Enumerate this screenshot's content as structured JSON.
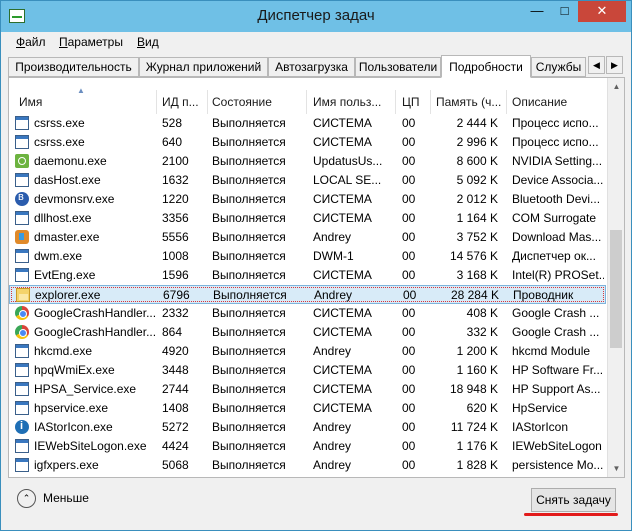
{
  "window": {
    "title": "Диспетчер задач",
    "min_glyph": "—",
    "max_glyph": "□",
    "close_glyph": "✕"
  },
  "menu": [
    "Файл",
    "Параметры",
    "Вид"
  ],
  "tabs": [
    {
      "label": "Производительность",
      "active": false
    },
    {
      "label": "Журнал приложений",
      "active": false
    },
    {
      "label": "Автозагрузка",
      "active": false
    },
    {
      "label": "Пользователи",
      "active": false
    },
    {
      "label": "Подробности",
      "active": true
    },
    {
      "label": "Службы",
      "active": false
    }
  ],
  "tab_scroll": {
    "left": "◀",
    "right": "▶"
  },
  "columns": [
    "Имя",
    "ИД п...",
    "Состояние",
    "Имя польз...",
    "ЦП",
    "Память (ч...",
    "Описание"
  ],
  "sort_arrow": "▲",
  "processes": [
    {
      "name": "csrss.exe",
      "pid": "528",
      "status": "Выполняется",
      "user": "СИСТЕМА",
      "cpu": "00",
      "mem": "2 444 K",
      "desc": "Процесс испо...",
      "icon": "window-icon"
    },
    {
      "name": "csrss.exe",
      "pid": "640",
      "status": "Выполняется",
      "user": "СИСТЕМА",
      "cpu": "00",
      "mem": "2 996 K",
      "desc": "Процесс испо...",
      "icon": "window-icon"
    },
    {
      "name": "daemonu.exe",
      "pid": "2100",
      "status": "Выполняется",
      "user": "UpdatusUs...",
      "cpu": "00",
      "mem": "8 600 K",
      "desc": "NVIDIA Setting...",
      "icon": "nvidia-icon"
    },
    {
      "name": "dasHost.exe",
      "pid": "1632",
      "status": "Выполняется",
      "user": "LOCAL SE...",
      "cpu": "00",
      "mem": "5 092 K",
      "desc": "Device Associa...",
      "icon": "window-icon"
    },
    {
      "name": "devmonsrv.exe",
      "pid": "1220",
      "status": "Выполняется",
      "user": "СИСТЕМА",
      "cpu": "00",
      "mem": "2 012 K",
      "desc": "Bluetooth Devi...",
      "icon": "bluetooth-icon"
    },
    {
      "name": "dllhost.exe",
      "pid": "3356",
      "status": "Выполняется",
      "user": "СИСТЕМА",
      "cpu": "00",
      "mem": "1 164 K",
      "desc": "COM Surrogate",
      "icon": "window-icon"
    },
    {
      "name": "dmaster.exe",
      "pid": "5556",
      "status": "Выполняется",
      "user": "Andrey",
      "cpu": "00",
      "mem": "3 752 K",
      "desc": "Download Mas...",
      "icon": "download-master-icon"
    },
    {
      "name": "dwm.exe",
      "pid": "1008",
      "status": "Выполняется",
      "user": "DWM-1",
      "cpu": "00",
      "mem": "14 576 K",
      "desc": "Диспетчер ок...",
      "icon": "window-icon"
    },
    {
      "name": "EvtEng.exe",
      "pid": "1596",
      "status": "Выполняется",
      "user": "СИСТЕМА",
      "cpu": "00",
      "mem": "3 168 K",
      "desc": "Intel(R) PROSet...",
      "icon": "window-icon"
    },
    {
      "name": "explorer.exe",
      "pid": "6796",
      "status": "Выполняется",
      "user": "Andrey",
      "cpu": "00",
      "mem": "28 284 K",
      "desc": "Проводник",
      "icon": "folder-icon",
      "selected": true
    },
    {
      "name": "GoogleCrashHandler...",
      "pid": "2332",
      "status": "Выполняется",
      "user": "СИСТЕМА",
      "cpu": "00",
      "mem": "408 K",
      "desc": "Google Crash ...",
      "icon": "chrome-icon"
    },
    {
      "name": "GoogleCrashHandler...",
      "pid": "864",
      "status": "Выполняется",
      "user": "СИСТЕМА",
      "cpu": "00",
      "mem": "332 K",
      "desc": "Google Crash ...",
      "icon": "chrome-icon"
    },
    {
      "name": "hkcmd.exe",
      "pid": "4920",
      "status": "Выполняется",
      "user": "Andrey",
      "cpu": "00",
      "mem": "1 200 K",
      "desc": "hkcmd Module",
      "icon": "window-icon"
    },
    {
      "name": "hpqWmiEx.exe",
      "pid": "3448",
      "status": "Выполняется",
      "user": "СИСТЕМА",
      "cpu": "00",
      "mem": "1 160 K",
      "desc": "HP Software Fr...",
      "icon": "window-icon"
    },
    {
      "name": "HPSA_Service.exe",
      "pid": "2744",
      "status": "Выполняется",
      "user": "СИСТЕМА",
      "cpu": "00",
      "mem": "18 948 K",
      "desc": "HP Support As...",
      "icon": "window-icon"
    },
    {
      "name": "hpservice.exe",
      "pid": "1408",
      "status": "Выполняется",
      "user": "СИСТЕМА",
      "cpu": "00",
      "mem": "620 K",
      "desc": "HpService",
      "icon": "window-icon"
    },
    {
      "name": "IAStorIcon.exe",
      "pid": "5272",
      "status": "Выполняется",
      "user": "Andrey",
      "cpu": "00",
      "mem": "11 724 K",
      "desc": "IAStorIcon",
      "icon": "intel-storage-icon"
    },
    {
      "name": "IEWebSiteLogon.exe",
      "pid": "4424",
      "status": "Выполняется",
      "user": "Andrey",
      "cpu": "00",
      "mem": "1 176 K",
      "desc": "IEWebSiteLogon",
      "icon": "window-icon"
    },
    {
      "name": "igfxpers.exe",
      "pid": "5068",
      "status": "Выполняется",
      "user": "Andrey",
      "cpu": "00",
      "mem": "1 828 K",
      "desc": "persistence Mo...",
      "icon": "window-icon"
    }
  ],
  "scrollbar": {
    "up": "▲",
    "down": "▼"
  },
  "footer": {
    "less_label": "Меньше",
    "less_glyph": "⌃",
    "end_task_label": "Снять задачу"
  }
}
